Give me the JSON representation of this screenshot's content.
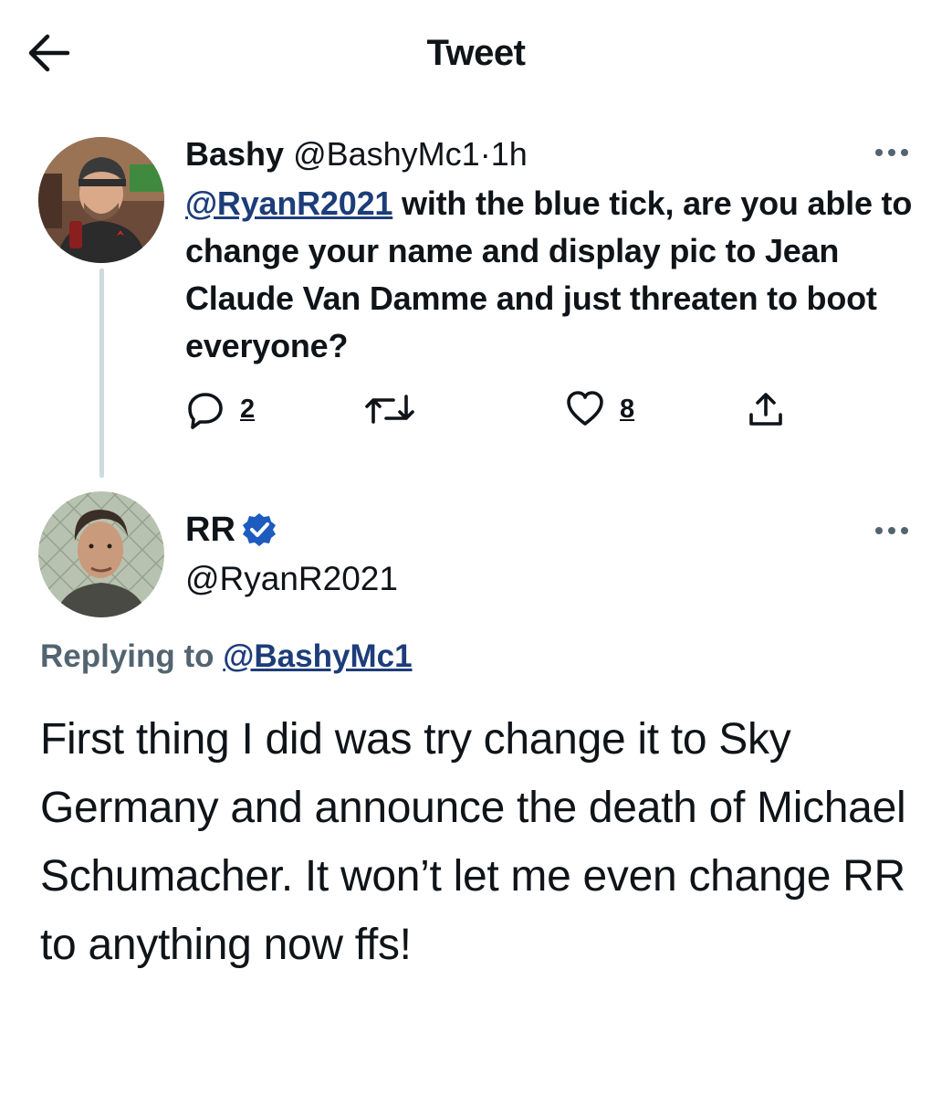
{
  "header": {
    "title": "Tweet",
    "back_icon": "arrow-left-icon"
  },
  "colors": {
    "text": "#0f1419",
    "secondary": "#536471",
    "mention": "#1d3d7a",
    "verified": "#1d5bbf",
    "thread_line": "#cfd9de",
    "background": "#ffffff"
  },
  "original_tweet": {
    "author_name": "Bashy",
    "handle": "@BashyMc1",
    "separator": "·",
    "time": "1h",
    "mention": "@RyanR2021",
    "text": " with the blue tick, are you able to change your name and display pic to Jean Claude Van Damme and just threaten to boot everyone?",
    "actions": {
      "reply_count": "2",
      "retweet_count": "",
      "like_count": "8"
    },
    "avatar_icon": "avatar-bashy"
  },
  "reply_tweet": {
    "author_name": "RR",
    "verified_icon": "verified-badge-icon",
    "handle": "@RyanR2021",
    "replying_to_label": "Replying to ",
    "replying_to_handle": "@BashyMc1",
    "text": "First thing I did was try change it to Sky Germany and announce the death of Michael Schumacher. It won’t let me even change RR to anything now ffs!",
    "avatar_icon": "avatar-rr"
  }
}
